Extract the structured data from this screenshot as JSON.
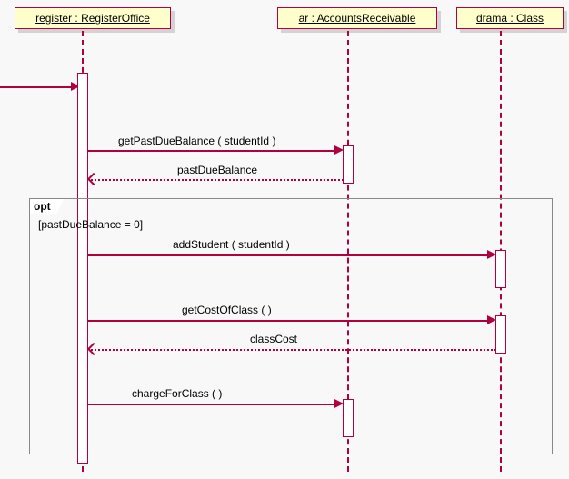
{
  "lifelines": {
    "register": {
      "label": "register : RegisterOffice"
    },
    "ar": {
      "label": "ar : AccountsReceivable"
    },
    "drama": {
      "label": "drama : Class"
    }
  },
  "messages": {
    "getPastDue": "getPastDueBalance ( studentId )",
    "pastDueBalance": "pastDueBalance",
    "addStudent": "addStudent ( studentId )",
    "getCost": "getCostOfClass (  )",
    "classCost": "classCost",
    "chargeForClass": "chargeForClass (  )"
  },
  "fragment": {
    "operator": "opt",
    "guard": "[pastDueBalance = 0]"
  },
  "chart_data": {
    "type": "sequence-diagram",
    "title": "",
    "participants": [
      {
        "id": "register",
        "name": "register",
        "type": "RegisterOffice"
      },
      {
        "id": "ar",
        "name": "ar",
        "type": "AccountsReceivable"
      },
      {
        "id": "drama",
        "name": "drama",
        "type": "Class"
      }
    ],
    "interactions": [
      {
        "from": "external",
        "to": "register",
        "kind": "found",
        "message": ""
      },
      {
        "from": "register",
        "to": "ar",
        "kind": "sync",
        "message": "getPastDueBalance ( studentId )"
      },
      {
        "from": "ar",
        "to": "register",
        "kind": "return",
        "message": "pastDueBalance"
      },
      {
        "fragment": "opt",
        "guard": "[pastDueBalance = 0]",
        "interactions": [
          {
            "from": "register",
            "to": "drama",
            "kind": "sync",
            "message": "addStudent ( studentId )"
          },
          {
            "from": "register",
            "to": "drama",
            "kind": "sync",
            "message": "getCostOfClass (  )"
          },
          {
            "from": "drama",
            "to": "register",
            "kind": "return",
            "message": "classCost"
          },
          {
            "from": "register",
            "to": "ar",
            "kind": "sync",
            "message": "chargeForClass (  )"
          }
        ]
      }
    ]
  }
}
